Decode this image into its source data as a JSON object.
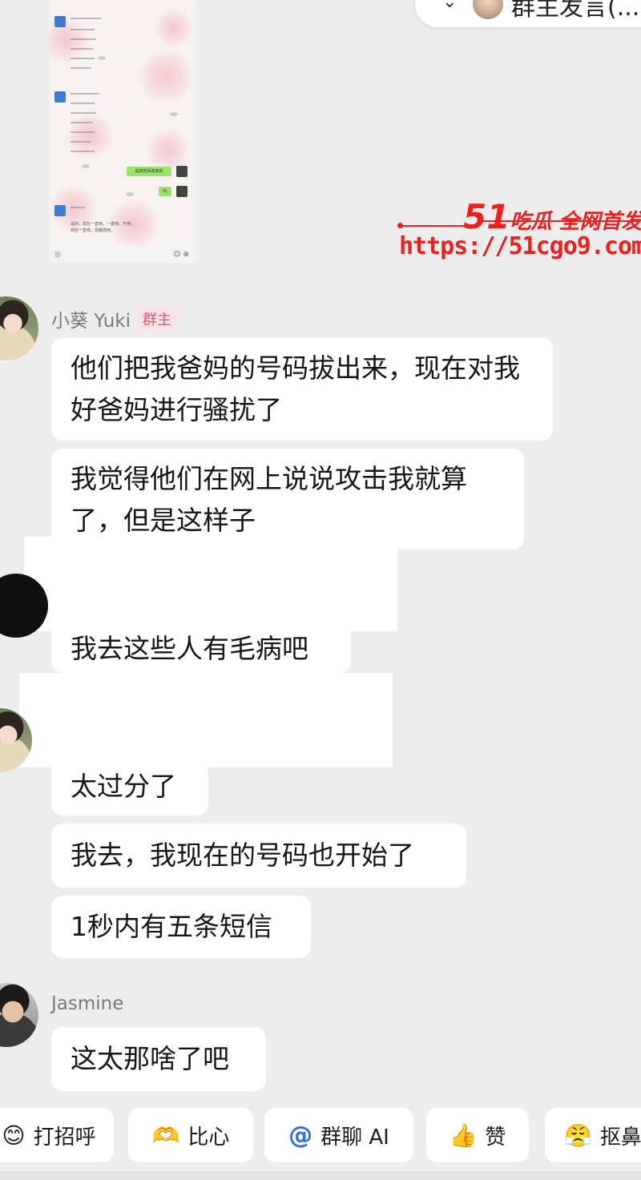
{
  "colors": {
    "background": "#ededed",
    "bubble": "#ffffff",
    "watermark": "#ee1f1f",
    "owner_badge_bg": "#fbe3e6",
    "owner_badge_text": "#e0536c",
    "mention_blue": "#2f6bf0"
  },
  "announcement": {
    "icon": "chevron-down-icon",
    "text": "群主发言(..."
  },
  "embedded_screenshot": {
    "green_bubble_1": "是突然间收到的",
    "green_bubble_2": "吗",
    "text_line_1": "是的，现在一直响，一直响，不停。",
    "text_line_2": "现在一直响，烦都烦死。"
  },
  "watermark": {
    "brand_number": "51",
    "brand_text": "吃瓜 全网首发",
    "url": "https://51cgo9.com"
  },
  "messages": {
    "yuki_name": "小葵 Yuki",
    "owner_badge": "群主",
    "m1": "他们把我爸妈的号码拔出来，现在对我好爸妈进行骚扰了",
    "m2": "我觉得他们在网上说说攻击我就算了，但是这样子",
    "m3": "我去这些人有毛病吧",
    "m4": "太过分了",
    "m5": "我去，我现在的号码也开始了",
    "m6": "1秒内有五条短信",
    "jasmine_name": "Jasmine",
    "m7": "这太那啥了吧"
  },
  "quick_actions": [
    {
      "icon": "wave-emoji-icon",
      "glyph": "😊",
      "label": "打招呼"
    },
    {
      "icon": "heart-hands-emoji-icon",
      "glyph": "🫶",
      "label": "比心"
    },
    {
      "icon": "at-icon",
      "glyph": "@",
      "label": "群聊 AI"
    },
    {
      "icon": "thumbs-up-icon",
      "glyph": "👍",
      "label": "赞"
    },
    {
      "icon": "nose-pick-emoji-icon",
      "glyph": "😤",
      "label": "抠鼻"
    }
  ]
}
